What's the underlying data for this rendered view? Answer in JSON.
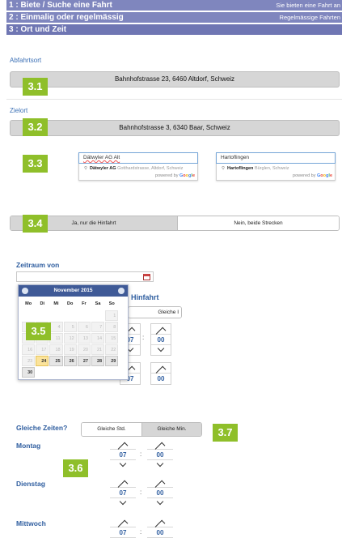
{
  "steps": [
    {
      "label": "1 : Biete / Suche eine Fahrt",
      "right": "Sie bieten eine Fahrt an"
    },
    {
      "label": "2 : Einmalig oder regelmässig",
      "right": "Regelmässige Fahrten"
    },
    {
      "label": "3 : Ort und Zeit",
      "right": ""
    }
  ],
  "abfahrtsort": {
    "label": "Abfahrtsort",
    "value": "Bahnhofstrasse 23, 6460 Altdorf, Schweiz",
    "badge": "3.1"
  },
  "zielort": {
    "label": "Zielort",
    "value": "Bahnhofstrasse 3, 6340 Baar, Schweiz",
    "badge": "3.2"
  },
  "autocomplete": {
    "badge": "3.3",
    "left": {
      "input": "Dätwyler AG Alt",
      "item_bold": "Dätwyler AG",
      "item_rest": "Gotthardstrasse, Altdorf, Schweiz"
    },
    "right": {
      "input": "Hartoflingen",
      "item_bold": "Hartoflingen",
      "item_rest": "Bürglen, Schweiz"
    },
    "powered_by": "powered by",
    "google": "Google"
  },
  "direction": {
    "badge": "3.4",
    "option1": "Ja, nur die Hinfahrt",
    "option2": "Nein, beide Strecken"
  },
  "zeitraum": {
    "label": "Zeitraum von",
    "badge": "3.5"
  },
  "calendar": {
    "title": "November 2015",
    "weekdays": [
      "Mo",
      "Di",
      "Mi",
      "Do",
      "Fr",
      "Sa",
      "So"
    ],
    "today": "24",
    "rows": [
      [
        "",
        "",
        "",
        "",
        "",
        "",
        "1"
      ],
      [
        "2",
        "3",
        "4",
        "5",
        "6",
        "7",
        "8"
      ],
      [
        "9",
        "10",
        "11",
        "12",
        "13",
        "14",
        "15"
      ],
      [
        "16",
        "17",
        "18",
        "19",
        "20",
        "21",
        "22"
      ],
      [
        "23",
        "24",
        "25",
        "26",
        "27",
        "28",
        "29"
      ],
      [
        "30",
        "",
        "",
        "",
        "",
        "",
        ""
      ]
    ]
  },
  "behind_calendar": {
    "hinfahrt": "Hinfahrt",
    "gleiche": "Gleiche I",
    "h1": "07",
    "m1": "00",
    "h2": "07",
    "m2": "00"
  },
  "gleiche_zeiten": {
    "label": "Gleiche Zeiten?",
    "opt1": "Gleiche Std.",
    "opt2": "Gleiche Min.",
    "badge": "3.7"
  },
  "days": [
    {
      "name": "Montag",
      "hour": "07",
      "min": "00"
    },
    {
      "name": "Dienstag",
      "hour": "07",
      "min": "00"
    },
    {
      "name": "Mittwoch",
      "hour": "07",
      "min": "00"
    }
  ],
  "days_badge": "3.6",
  "colors": {
    "step_bar": "#7f86be",
    "badge": "#8fbf2a",
    "label_blue": "#3a6fb5",
    "calendar_header": "#3f5a97",
    "today": "#fbe39b"
  }
}
